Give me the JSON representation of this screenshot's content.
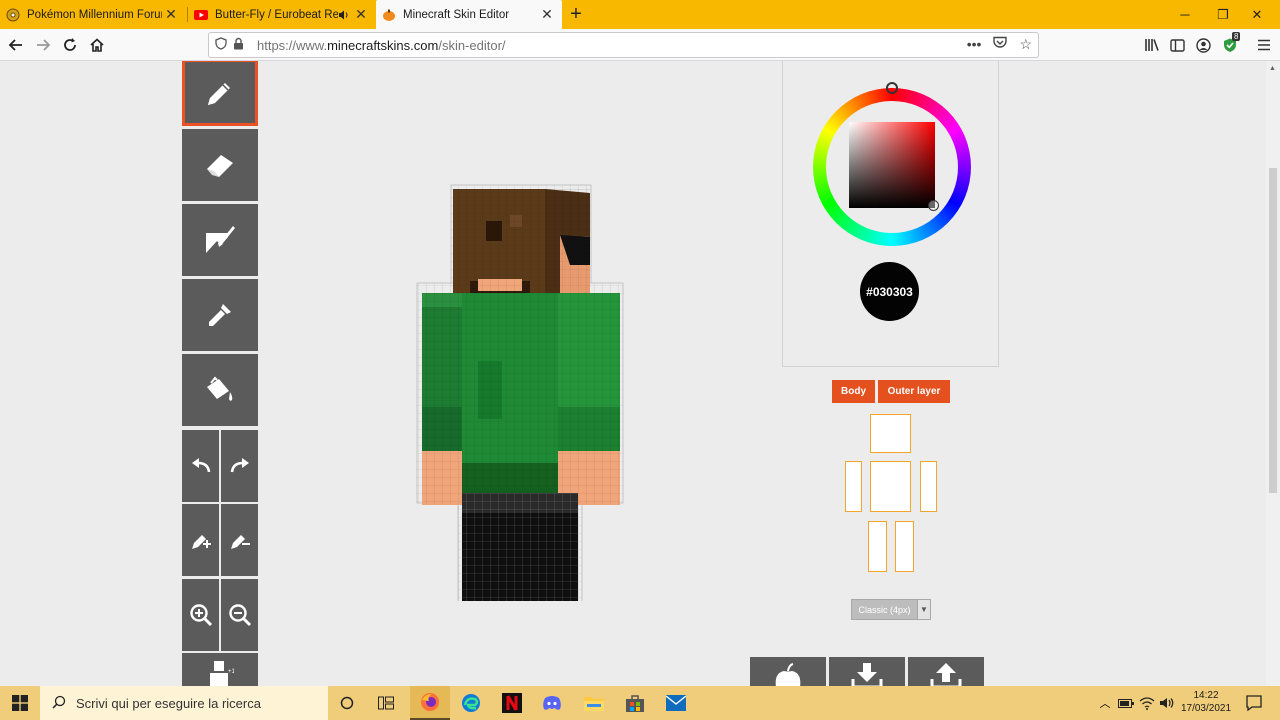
{
  "tabs": [
    {
      "title": "Pokémon Millennium Forum ~ ",
      "active": false
    },
    {
      "title": "Butter-Fly / Eurobeat Remix",
      "active": false,
      "audio": true
    },
    {
      "title": "Minecraft Skin Editor",
      "active": true
    }
  ],
  "url": {
    "protocol": "https://www.",
    "domain": "minecraftskins.com",
    "path": "/skin-editor/"
  },
  "extensions": {
    "shield_badge": "8"
  },
  "tools": [
    "pencil",
    "eraser",
    "paint-brush",
    "eyedropper",
    "bucket",
    "undo",
    "redo",
    "lighten",
    "darken",
    "zoom-in",
    "zoom-out",
    "toggle-parts"
  ],
  "color": {
    "hex": "#030303",
    "label": "#030303"
  },
  "layers": {
    "body": "Body",
    "outer": "Outer layer"
  },
  "model_select": {
    "value": "Classic (4px)"
  },
  "actions": [
    "reset",
    "download",
    "upload"
  ],
  "taskbar": {
    "search_placeholder": "Scrivi qui per eseguire la ricerca",
    "time": "14:22",
    "date": "17/03/2021"
  },
  "colors": {
    "accent": "#ec5324",
    "tool_bg": "#5b5b5b",
    "tab_bar": "#f9b800",
    "taskbar": "#f0cd7a"
  }
}
